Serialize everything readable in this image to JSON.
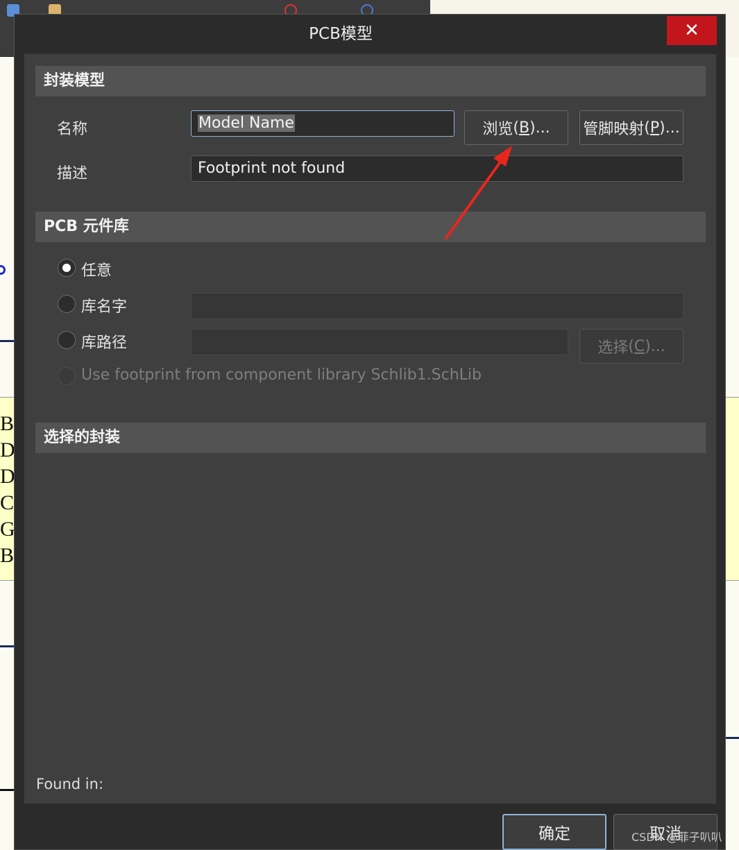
{
  "dialog": {
    "title": "PCB模型",
    "close_glyph": "✕"
  },
  "footprint_model": {
    "header": "封装模型",
    "name_label": "名称",
    "name_value": "Model Name",
    "browse_button": {
      "text": "浏览 ",
      "mnemonic": "B",
      "suffix": ")...",
      "prefix": "("
    },
    "pin_map_button": {
      "text": "管脚映射 ",
      "mnemonic": "P",
      "suffix": ")...",
      "prefix": "("
    },
    "description_label": "描述",
    "description_value": "Footprint not found"
  },
  "pcb_library": {
    "header": "PCB 元件库",
    "options": [
      {
        "label": "任意",
        "checked": true,
        "enabled": true
      },
      {
        "label": "库名字",
        "checked": false,
        "enabled": true
      },
      {
        "label": "库路径",
        "checked": false,
        "enabled": true
      },
      {
        "label": "Use footprint from component library Schlib1.SchLib",
        "checked": false,
        "enabled": false
      }
    ],
    "library_name_value": "",
    "library_path_value": "",
    "choose_button": {
      "text": "选择 ",
      "mnemonic": "C",
      "suffix": ")...",
      "prefix": "("
    }
  },
  "selected_footprint": {
    "header": "选择的封装"
  },
  "found_in_label": "Found in:",
  "footer": {
    "ok_label": "确定",
    "cancel_label": "取消"
  },
  "watermark": "CSDN @菲子叭叭",
  "background": {
    "left_letters": [
      "B",
      "D",
      "D",
      "C",
      "G",
      "B"
    ]
  },
  "colors": {
    "close_button": "#c3161c",
    "focus_border": "#8fb4d8",
    "annotation_arrow": "#e8261e"
  },
  "icons": {
    "close": "close-icon",
    "annotation": "red-arrow-icon"
  }
}
